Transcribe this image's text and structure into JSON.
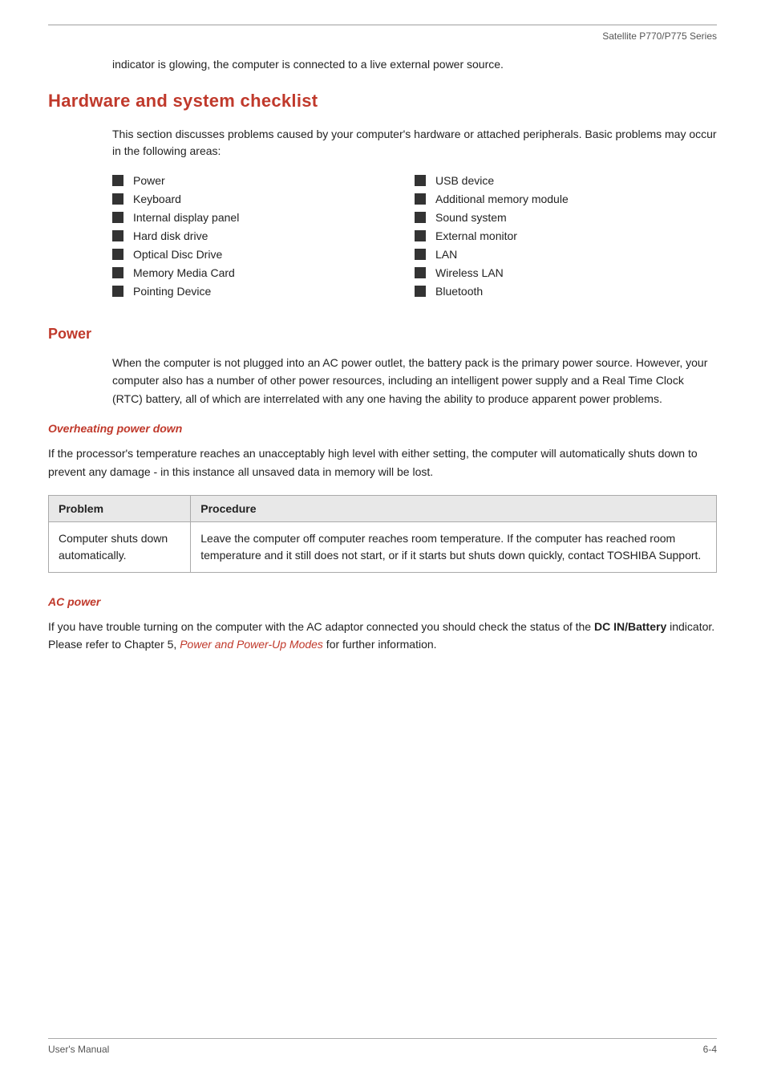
{
  "header": {
    "series": "Satellite P770/P775 Series",
    "border": true
  },
  "intro": {
    "text": "indicator is glowing, the computer is connected to a live external power source."
  },
  "hardware_section": {
    "title": "Hardware and system checklist",
    "intro": "This section discusses problems caused by your computer's hardware or attached peripherals. Basic problems may occur in the following areas:",
    "col1_items": [
      "Power",
      "Keyboard",
      "Internal display panel",
      "Hard disk drive",
      "Optical Disc Drive",
      "Memory Media Card",
      "Pointing Device"
    ],
    "col2_items": [
      "USB device",
      "Additional memory module",
      "Sound system",
      "External monitor",
      "LAN",
      "Wireless LAN",
      "Bluetooth"
    ]
  },
  "power_section": {
    "title": "Power",
    "body": "When the computer is not plugged into an AC power outlet, the battery pack is the primary power source. However, your computer also has a number of other power resources, including an intelligent power supply and a Real Time Clock (RTC) battery, all of which are interrelated with any one having the ability to produce apparent power problems.",
    "overheating": {
      "title": "Overheating power down",
      "body": "If the processor's temperature reaches an unacceptably high level with either setting, the computer will automatically shuts down to prevent any damage - in this instance all unsaved data in memory will be lost.",
      "table": {
        "headers": [
          "Problem",
          "Procedure"
        ],
        "rows": [
          {
            "problem": "Computer shuts down automatically.",
            "procedure": "Leave the computer off computer reaches room temperature. If the computer has reached room temperature and it still does not start, or if it starts but shuts down quickly, contact TOSHIBA Support."
          }
        ]
      }
    },
    "ac_power": {
      "title": "AC power",
      "body_before": "If you have trouble turning on the computer with the AC adaptor connected you should check the status of the ",
      "bold": "DC IN/Battery",
      "body_middle": " indicator. Please refer to Chapter 5, ",
      "link": "Power and Power-Up Modes",
      "body_after": " for further information."
    }
  },
  "footer": {
    "left": "User's Manual",
    "right": "6-4"
  }
}
